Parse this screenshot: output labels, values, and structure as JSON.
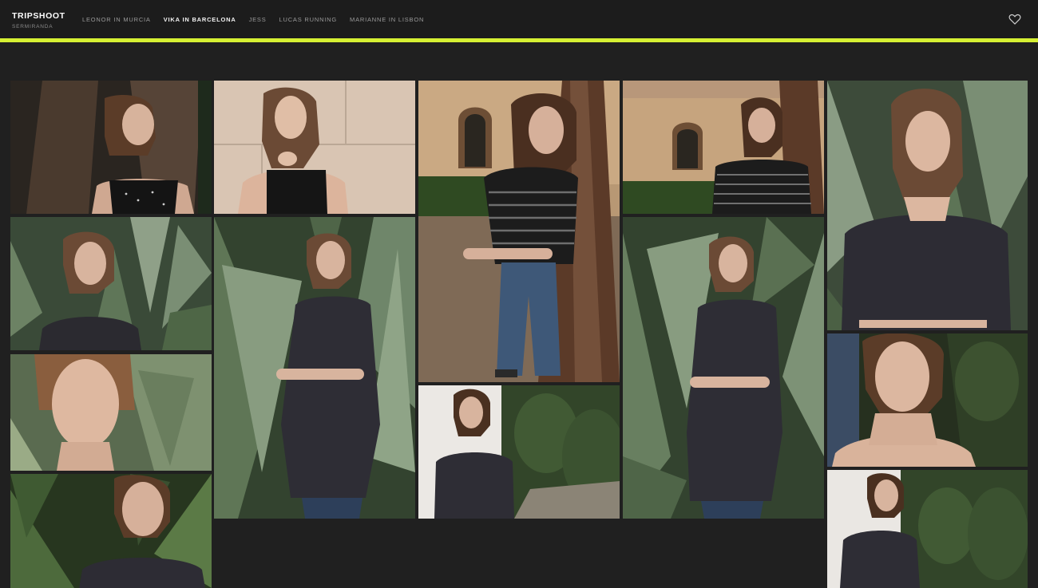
{
  "brand": {
    "title": "TRIPSHOOT",
    "subtitle": "SERMIRANDA"
  },
  "nav": {
    "items": [
      {
        "label": "LEONOR IN MURCIA",
        "active": false
      },
      {
        "label": "VIKA IN BARCELONA",
        "active": true
      },
      {
        "label": "JESS",
        "active": false
      },
      {
        "label": "LUCAS RUNNING",
        "active": false
      },
      {
        "label": "MARIANNE IN LISBON",
        "active": false
      }
    ]
  },
  "icons": {
    "favorite": "heart-outline-icon"
  },
  "colors": {
    "accent": "#d6f033",
    "background": "#202020",
    "topbar": "#1c1c1c"
  },
  "gallery": {
    "photos": [
      {
        "scene": "tree-trunk",
        "outfit": "black-dot-top"
      },
      {
        "scene": "stone-wall",
        "outfit": "black-dot-top"
      },
      {
        "scene": "tree-window",
        "outfit": "striped-tee-jeans"
      },
      {
        "scene": "tree-window",
        "outfit": "striped-tee"
      },
      {
        "scene": "agave",
        "outfit": "floral-dress"
      },
      {
        "scene": "agave",
        "outfit": "floral-dress"
      },
      {
        "scene": "agave",
        "outfit": "floral-dress"
      },
      {
        "scene": "agave",
        "outfit": "floral-dress"
      },
      {
        "scene": "agave",
        "outfit": "bare-shoulders"
      },
      {
        "scene": "white-wall-garden",
        "outfit": "floral-dress"
      },
      {
        "scene": "dark-green",
        "outfit": "bare-shoulders"
      },
      {
        "scene": "palm-leaves",
        "outfit": "floral-dress"
      },
      {
        "scene": "white-wall-garden",
        "outfit": "floral-dress"
      }
    ]
  }
}
